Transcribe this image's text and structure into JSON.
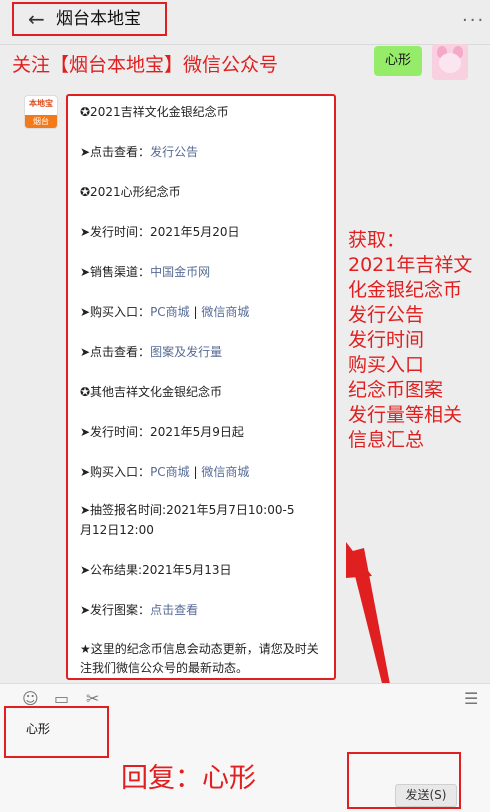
{
  "header": {
    "title": "烟台本地宝",
    "back_icon": "←",
    "more_icon": "···"
  },
  "promo_text": "关注【烟台本地宝】微信公众号",
  "user_message": "心形",
  "logo": {
    "top": "本地宝",
    "bottom": "烟台"
  },
  "message": {
    "l1": "✪2021吉祥文化金银纪念币",
    "l2_prefix": "➤点击查看：",
    "l2_link": "发行公告",
    "l3": "✪2021心形纪念币",
    "l4": "➤发行时间：2021年5月20日",
    "l5_prefix": "➤销售渠道：",
    "l5_link": "中国金币网",
    "l6_prefix": "➤购买入口：",
    "l6_link1": "PC商城",
    "l6_sep": " | ",
    "l6_link2": "微信商城",
    "l7_prefix": "➤点击查看：",
    "l7_link": "图案及发行量",
    "l8": "✪其他吉祥文化金银纪念币",
    "l9": "➤发行时间：2021年5月9日起",
    "l10_prefix": "➤购买入口：",
    "l10_link1": "PC商城",
    "l10_sep": " | ",
    "l10_link2": "微信商城",
    "l11a": "➤抽签报名时间:2021年5月7日10:00-5",
    "l11b": "月12日12:00",
    "l12": "➤公布结果:2021年5月13日",
    "l13_prefix": "➤发行图案：",
    "l13_link": "点击查看",
    "note": "★这里的纪念币信息会动态更新，请您及时关注我们微信公众号的最新动态。"
  },
  "side_note": [
    "获取：",
    "2021年吉祥文",
    "化金银纪念币",
    "发行公告",
    "发行时间",
    "购买入口",
    "纪念币图案",
    "发行量等相关",
    "信息汇总"
  ],
  "input": {
    "text": "心形",
    "send_label": "发送(S)"
  },
  "reply_caption": "回复：心形",
  "colors": {
    "accent": "#e02020",
    "link": "#576b95",
    "bubble": "#95ec69"
  }
}
